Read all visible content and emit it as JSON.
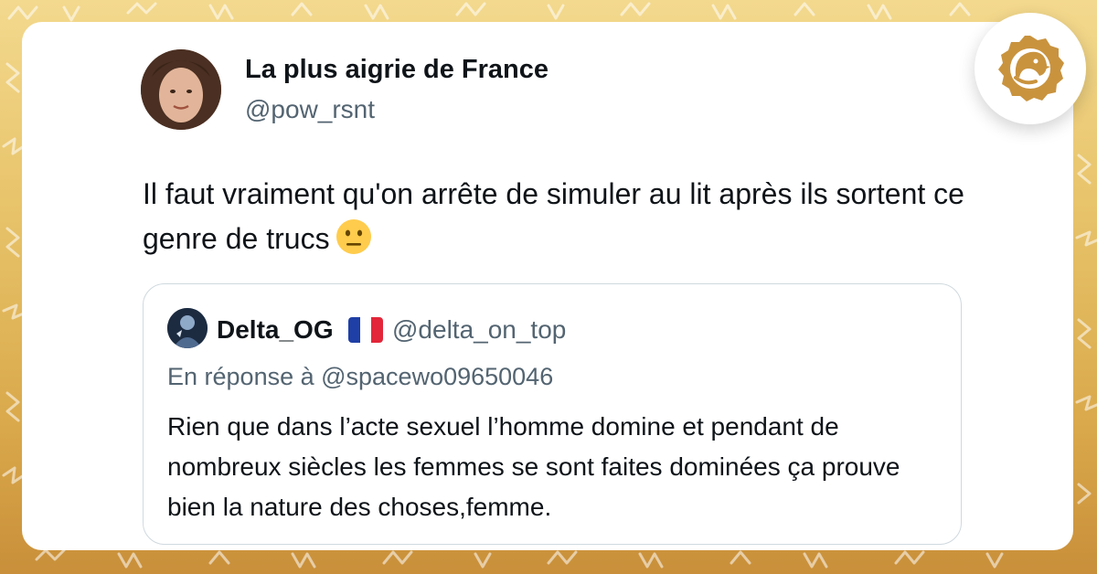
{
  "colors": {
    "background_gold": "#e2b85a",
    "card": "#ffffff",
    "text_primary": "#0f1419",
    "text_secondary": "#536471",
    "quote_border": "#cfd9de",
    "logo_gold": "#c9933e"
  },
  "tweet": {
    "author_name": "La plus aigrie de France",
    "author_handle": "@pow_rsnt",
    "text": "Il faut vraiment qu'on arrête de simuler au lit après ils sortent ce genre de trucs",
    "emoji": "neutral-face-emoji"
  },
  "quoted_tweet": {
    "author_name": "Delta_OG",
    "flag": "france-flag-emoji",
    "author_handle": "@delta_on_top",
    "reply_to": "En réponse à @spacewo09650046",
    "text": "Rien que dans l’acte sexuel l’homme domine et pendant de nombreux siècles les femmes se sont faites dominées ça prouve bien la nature des choses,femme."
  },
  "brand": {
    "logo_icon": "bird-logo-icon"
  }
}
